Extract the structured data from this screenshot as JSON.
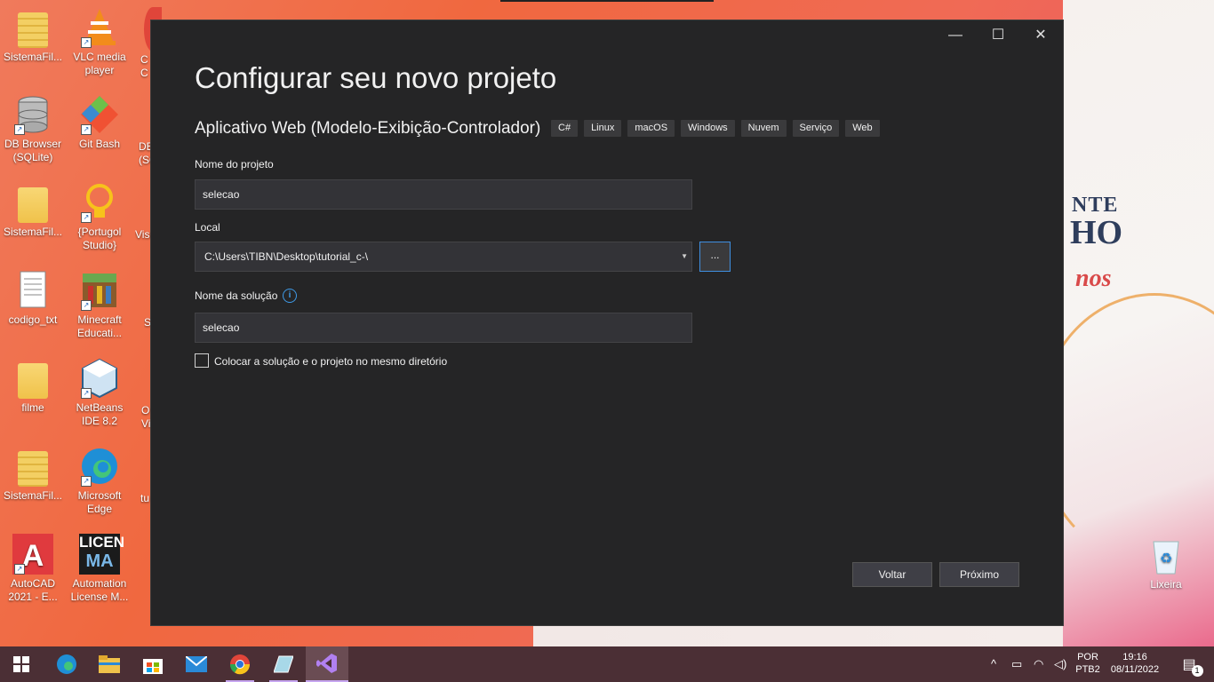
{
  "desktop": {
    "icons": [
      {
        "label": "SistemaFil...",
        "icon": "zip-folder-icon"
      },
      {
        "label": "VLC media player",
        "icon": "vlc-icon"
      },
      {
        "label": "DB Browser (SQLite)",
        "icon": "database-icon"
      },
      {
        "label": "Git Bash",
        "icon": "git-icon"
      },
      {
        "label": "SistemaFil...",
        "icon": "folder-icon"
      },
      {
        "label": "{Portugol Studio}",
        "icon": "lightbulb-icon"
      },
      {
        "label": "codigo_txt",
        "icon": "text-file-icon"
      },
      {
        "label": "Minecraft Educati...",
        "icon": "minecraft-icon"
      },
      {
        "label": "filme",
        "icon": "folder-icon"
      },
      {
        "label": "NetBeans IDE 8.2",
        "icon": "netbeans-icon"
      },
      {
        "label": "SistemaFil...",
        "icon": "zip-folder-icon"
      },
      {
        "label": "Microsoft Edge",
        "icon": "edge-icon"
      },
      {
        "label": "AutoCAD 2021 - E...",
        "icon": "autocad-icon"
      },
      {
        "label": "Automation License M...",
        "icon": "license-manager-icon"
      }
    ],
    "partial_labels": {
      "c1": "C",
      "c1b": "C",
      "c2": "DE",
      "c2b": "(SQ",
      "c3": "Visu",
      "c4": "S",
      "c5": "O",
      "c5b": "Vi",
      "c6": "tu"
    },
    "license_text_1": "LICEN",
    "license_text_2": "MA",
    "recycle_bin": "Lixeira",
    "wall_text": {
      "line1": "NTE",
      "line2": "HO",
      "line3": "nos"
    }
  },
  "dialog": {
    "title": "Configurar seu novo projeto",
    "template_name": "Aplicativo Web (Modelo-Exibição-Controlador)",
    "tags": [
      "C#",
      "Linux",
      "macOS",
      "Windows",
      "Nuvem",
      "Serviço",
      "Web"
    ],
    "project_name_label": "Nome do projeto",
    "project_name_value": "selecao",
    "location_label": "Local",
    "location_value": "C:\\Users\\TIBN\\Desktop\\tutorial_c-\\",
    "browse_label": "...",
    "solution_name_label": "Nome da solução",
    "solution_name_value": "selecao",
    "same_dir_label": "Colocar a solução e o projeto no mesmo diretório",
    "same_dir_checked": false,
    "back_button": "Voltar",
    "next_button": "Próximo"
  },
  "taskbar": {
    "language": "POR",
    "layout": "PTB2",
    "time": "19:16",
    "date": "08/11/2022",
    "notification_count": "1"
  },
  "colors": {
    "dialog_bg": "#252526",
    "field_bg": "#333337",
    "accent_blue": "#3f8fe0",
    "vs_purple": "#c7a6f0",
    "taskbar_bg": "#4b2f35"
  }
}
